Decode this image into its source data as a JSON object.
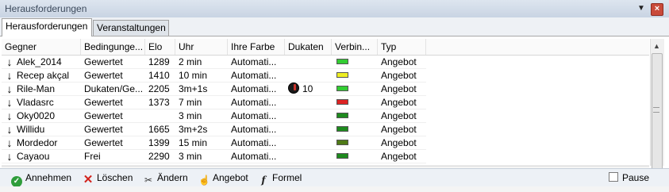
{
  "window": {
    "title": "Herausforderungen"
  },
  "tabs": [
    {
      "label": "Herausforderungen",
      "active": true
    },
    {
      "label": "Veranstaltungen",
      "active": false
    }
  ],
  "columns": [
    "Gegner",
    "Bedingunge...",
    "Elo",
    "Uhr",
    "Ihre Farbe",
    "Dukaten",
    "Verbin...",
    "Typ"
  ],
  "rows": [
    {
      "gegner": "Alek_2014",
      "bedingung": "Gewertet",
      "elo": "1289",
      "uhr": "2 min",
      "farbe": "Automati...",
      "dukaten": "",
      "verbindung": "green",
      "typ": "Angebot"
    },
    {
      "gegner": "Recep akçal",
      "bedingung": "Gewertet",
      "elo": "1410",
      "uhr": "10 min",
      "farbe": "Automati...",
      "dukaten": "",
      "verbindung": "yellow",
      "typ": "Angebot"
    },
    {
      "gegner": "Rile-Man",
      "bedingung": "Dukaten/Ge...",
      "elo": "2205",
      "uhr": "3m+1s",
      "farbe": "Automati...",
      "dukaten": "10",
      "verbindung": "green",
      "typ": "Angebot"
    },
    {
      "gegner": "Vladasrc",
      "bedingung": "Gewertet",
      "elo": "1373",
      "uhr": "7 min",
      "farbe": "Automati...",
      "dukaten": "",
      "verbindung": "red",
      "typ": "Angebot"
    },
    {
      "gegner": "Oky0020",
      "bedingung": "Gewertet",
      "elo": "",
      "uhr": "3 min",
      "farbe": "Automati...",
      "dukaten": "",
      "verbindung": "darkgreen",
      "typ": "Angebot"
    },
    {
      "gegner": "Willidu",
      "bedingung": "Gewertet",
      "elo": "1665",
      "uhr": "3m+2s",
      "farbe": "Automati...",
      "dukaten": "",
      "verbindung": "darkgreen",
      "typ": "Angebot"
    },
    {
      "gegner": "Mordedor",
      "bedingung": "Gewertet",
      "elo": "1399",
      "uhr": "15 min",
      "farbe": "Automati...",
      "dukaten": "",
      "verbindung": "olive",
      "typ": "Angebot"
    },
    {
      "gegner": "Cayaou",
      "bedingung": "Frei",
      "elo": "2290",
      "uhr": "3 min",
      "farbe": "Automati...",
      "dukaten": "",
      "verbindung": "darkgreen",
      "typ": "Angebot"
    }
  ],
  "connection_colors": {
    "green": "#33cc33",
    "yellow": "#eeee22",
    "red": "#dd2222",
    "darkgreen": "#1e8a1e",
    "olive": "#4f7a16"
  },
  "toolbar": {
    "accept": "Annehmen",
    "delete": "Löschen",
    "edit": "Ändern",
    "offer": "Angebot",
    "formula": "Formel",
    "pause": "Pause"
  },
  "icons": {
    "accept": "check-circle-icon",
    "delete": "red-x-icon",
    "edit": "scissors-icon",
    "offer": "hand-icon",
    "formula": "fx-icon",
    "row": "arrow-down-icon",
    "dukaten": "coin-icon"
  }
}
